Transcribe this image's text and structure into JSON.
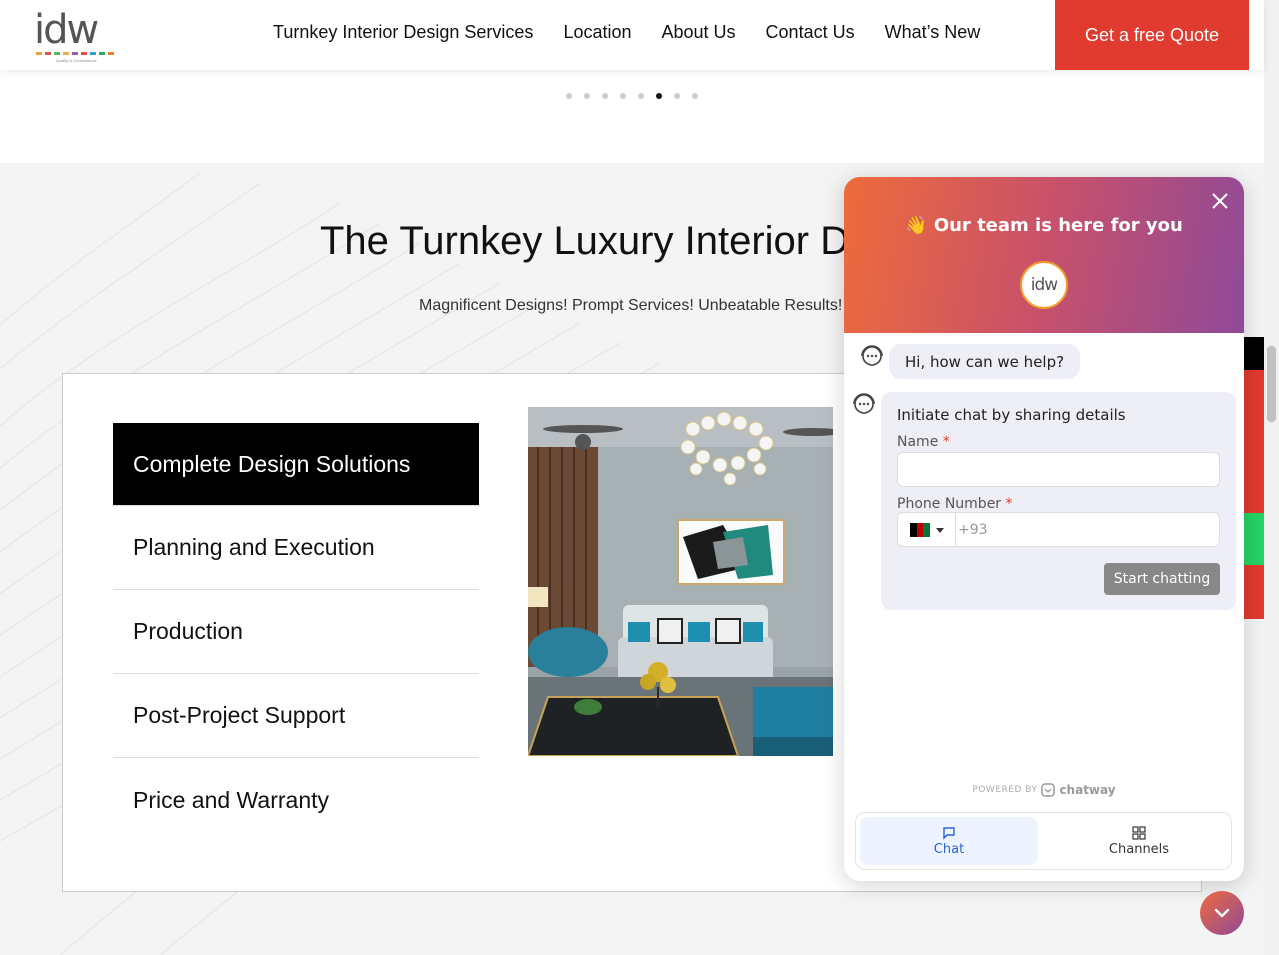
{
  "logo": {
    "text": "idw",
    "tagline": "Quality & Convenience"
  },
  "nav": {
    "items": [
      {
        "label": "Turnkey Interior Design Services"
      },
      {
        "label": "Location"
      },
      {
        "label": "About Us"
      },
      {
        "label": "Contact Us"
      },
      {
        "label": "What’s New"
      }
    ],
    "quote_label": "Get a free Quote"
  },
  "carousel": {
    "dot_count": 8,
    "active_index": 5
  },
  "section": {
    "title": "The Turnkey Luxury Interior D",
    "subtitle": "Magnificent Designs! Prompt Services! Unbeatable Results!",
    "tabs": [
      {
        "label": "Complete Design Solutions",
        "active": true
      },
      {
        "label": "Planning and Execution",
        "active": false
      },
      {
        "label": "Production",
        "active": false
      },
      {
        "label": "Post-Project Support",
        "active": false
      },
      {
        "label": "Price and Warranty",
        "active": false
      }
    ]
  },
  "chat": {
    "header_title": "👋 Our team is here for you",
    "avatar_text": "idw",
    "greeting": "Hi, how can we help?",
    "form": {
      "title": "Initiate chat by sharing details",
      "name_label": "Name",
      "name_value": "",
      "phone_label": "Phone Number",
      "required_mark": "*",
      "phone_placeholder": "+93",
      "country": "Afghanistan",
      "submit_label": "Start chatting"
    },
    "powered_by": "POWERED BY",
    "brand": "chatway",
    "tabs": [
      {
        "label": "Chat",
        "icon": "chat-bubble-icon",
        "active": true
      },
      {
        "label": "Channels",
        "icon": "grid-icon",
        "active": false
      }
    ]
  },
  "colors": {
    "accent_red": "#e13a2f",
    "chat_gradient_start": "#ee6b3b",
    "chat_gradient_end": "#8f4a99",
    "chat_active_tab": "#2a63d4"
  }
}
